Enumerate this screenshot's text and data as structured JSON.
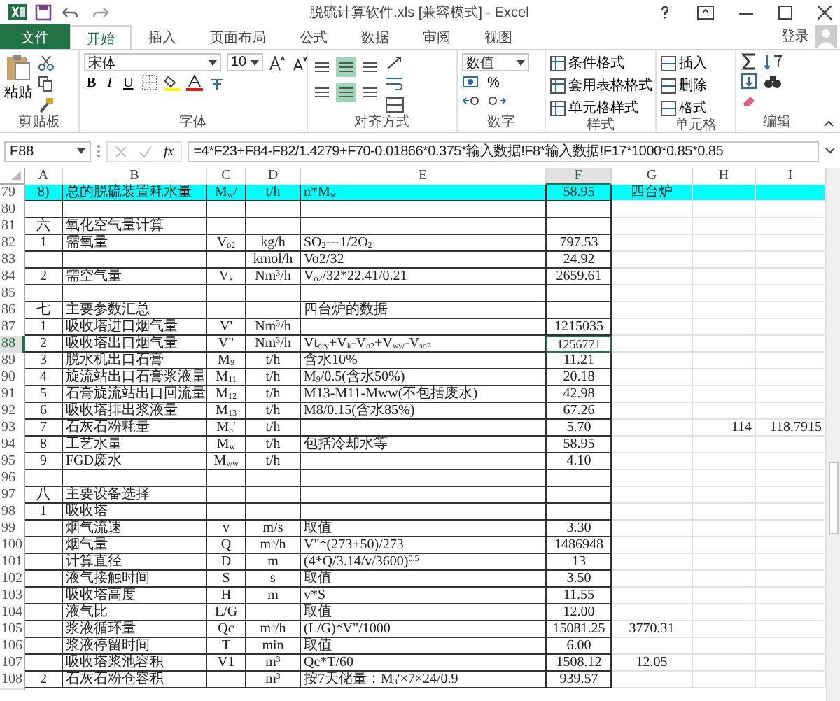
{
  "window": {
    "title": "脱硫计算软件.xls  [兼容模式] - Excel"
  },
  "tabs": [
    {
      "label": "文件",
      "kind": "file",
      "selected": false
    },
    {
      "label": "开始",
      "kind": "tab",
      "selected": true
    },
    {
      "label": "插入",
      "kind": "tab",
      "selected": false
    },
    {
      "label": "页面布局",
      "kind": "tab",
      "selected": false
    },
    {
      "label": "公式",
      "kind": "tab",
      "selected": false
    },
    {
      "label": "数据",
      "kind": "tab",
      "selected": false
    },
    {
      "label": "审阅",
      "kind": "tab",
      "selected": false
    },
    {
      "label": "视图",
      "kind": "tab",
      "selected": false
    }
  ],
  "signin": "登录",
  "ribbon": {
    "clipboard": {
      "paste": "粘贴",
      "label": "剪贴板"
    },
    "font": {
      "name": "宋体",
      "size": "10",
      "styles": [
        "B",
        "I",
        "U"
      ],
      "label": "字体"
    },
    "alignment": {
      "buttons": [
        {
          "selected": false
        },
        {
          "selected": true
        },
        {
          "selected": false
        },
        {
          "selected": false
        },
        {
          "selected": true
        },
        {
          "selected": false
        }
      ],
      "label": "对齐方式"
    },
    "number": {
      "format": "数值",
      "percent": "%",
      "label": "数字"
    },
    "styles": {
      "items": [
        "条件格式",
        "套用表格格式",
        "单元格样式"
      ],
      "label": "样式"
    },
    "cells": {
      "items": [
        "插入",
        "删除",
        "格式"
      ],
      "label": "单元格"
    },
    "editing": {
      "label": "编辑"
    }
  },
  "formula_bar": {
    "name_box": "F88",
    "fx": "fx",
    "formula": "=4*F23+F84-F82/1.4279+F70-0.01866*0.375*输入数据!F8*输入数据!F17*1000*0.85*0.85"
  },
  "columns": [
    {
      "label": "A",
      "selected": false
    },
    {
      "label": "B",
      "selected": false
    },
    {
      "label": "C",
      "selected": false
    },
    {
      "label": "D",
      "selected": false
    },
    {
      "label": "E",
      "selected": false
    },
    {
      "label": "F",
      "selected": true
    },
    {
      "label": "G",
      "selected": false
    },
    {
      "label": "H",
      "selected": false
    },
    {
      "label": "I",
      "selected": false
    }
  ],
  "rows": [
    {
      "row": "79",
      "selected": false,
      "highlighted": true,
      "cells": {
        "a": "8)",
        "b": "总的脱硫装置耗水量",
        "c": "M$_{w}$/",
        "d": "t/h",
        "e": "n*M$_{w}$",
        "f": "58.95",
        "g": "四台炉"
      }
    },
    {
      "row": "80",
      "selected": false,
      "highlighted": false,
      "cells": {}
    },
    {
      "row": "81",
      "selected": false,
      "highlighted": false,
      "cells": {
        "a": "六",
        "b": "氧化空气量计算"
      }
    },
    {
      "row": "82",
      "selected": false,
      "highlighted": false,
      "cells": {
        "a": "1",
        "b": "需氧量",
        "c": "V$_{o2}$",
        "d": "kg/h",
        "e": "SO$_{2}$---1/2O$_{2}$",
        "f": "797.53"
      }
    },
    {
      "row": "83",
      "selected": false,
      "highlighted": false,
      "cells": {
        "d": "kmol/h",
        "e": "Vo2/32",
        "f": "24.92"
      }
    },
    {
      "row": "84",
      "selected": false,
      "highlighted": false,
      "cells": {
        "a": "2",
        "b": "需空气量",
        "c": "V$_{k}$",
        "d": "Nm$^{3}$/h",
        "e": "V$_{o2}$/32*22.41/0.21",
        "f": "2659.61"
      }
    },
    {
      "row": "85",
      "selected": false,
      "highlighted": false,
      "cells": {}
    },
    {
      "row": "86",
      "selected": false,
      "highlighted": false,
      "cells": {
        "a": "七",
        "b": "主要参数汇总",
        "e": "四台炉的数据"
      }
    },
    {
      "row": "87",
      "selected": false,
      "highlighted": false,
      "cells": {
        "a": "1",
        "b": "吸收塔进口烟气量",
        "c": "V'",
        "d": "Nm$^{3}$/h",
        "f": "1215035"
      }
    },
    {
      "row": "88",
      "selected": true,
      "highlighted": false,
      "cells": {
        "a": "2",
        "b": "吸收塔出口烟气量",
        "c": "V\"",
        "d": "Nm$^{3}$/h",
        "e": "Vt$_{dry}$+V$_{k}$-V$_{o2}$+V$_{ww}$-V$_{so2}$",
        "f": "1256771"
      }
    },
    {
      "row": "89",
      "selected": false,
      "highlighted": false,
      "cells": {
        "a": "3",
        "b": "脱水机出口石膏",
        "c": "M$_{9}$",
        "d": "t/h",
        "e": "含水10%",
        "f": "11.21"
      }
    },
    {
      "row": "90",
      "selected": false,
      "highlighted": false,
      "cells": {
        "a": "4",
        "b": "旋流站出口石膏浆液量",
        "c": "M$_{11}$",
        "d": "t/h",
        "e": "M$_{9}$/0.5(含水50%)",
        "f": "20.18"
      }
    },
    {
      "row": "91",
      "selected": false,
      "highlighted": false,
      "cells": {
        "a": "5",
        "b": "石膏旋流站出口回流量",
        "c": "M$_{12}$",
        "d": "t/h",
        "e": "M13-M11-Mww(不包括废水)",
        "f": "42.98"
      }
    },
    {
      "row": "92",
      "selected": false,
      "highlighted": false,
      "cells": {
        "a": "6",
        "b": "吸收塔排出浆液量",
        "c": "M$_{13}$",
        "d": "t/h",
        "e": "M8/0.15(含水85%)",
        "f": "67.26"
      }
    },
    {
      "row": "93",
      "selected": false,
      "highlighted": false,
      "cells": {
        "a": "7",
        "b": "石灰石粉耗量",
        "c": "M$_{3}$'",
        "d": "t/h",
        "f": "5.70",
        "h": "114",
        "i": "118.7915"
      }
    },
    {
      "row": "94",
      "selected": false,
      "highlighted": false,
      "cells": {
        "a": "8",
        "b": "工艺水量",
        "c": "M$_{w}$",
        "d": "t/h",
        "e": "包括冷却水等",
        "f": "58.95"
      }
    },
    {
      "row": "95",
      "selected": false,
      "highlighted": false,
      "cells": {
        "a": "9",
        "b": "FGD废水",
        "c": "M$_{ww}$",
        "d": "t/h",
        "f": "4.10"
      }
    },
    {
      "row": "96",
      "selected": false,
      "highlighted": false,
      "cells": {}
    },
    {
      "row": "97",
      "selected": false,
      "highlighted": false,
      "cells": {
        "a": "八",
        "b": "主要设备选择"
      }
    },
    {
      "row": "98",
      "selected": false,
      "highlighted": false,
      "cells": {
        "a": "1",
        "b": "吸收塔"
      }
    },
    {
      "row": "99",
      "selected": false,
      "highlighted": false,
      "cells": {
        "b": "烟气流速",
        "c": "v",
        "d": "m/s",
        "e": "取值",
        "f": "3.30"
      }
    },
    {
      "row": "100",
      "selected": false,
      "highlighted": false,
      "cells": {
        "b": "烟气量",
        "c": "Q",
        "d": "m$^{3}$/h",
        "e": "V\"*(273+50)/273",
        "f": "1486948"
      }
    },
    {
      "row": "101",
      "selected": false,
      "highlighted": false,
      "cells": {
        "b": "计算直径",
        "c": "D",
        "d": "m",
        "e": "(4*Q/3.14/v/3600)$^{0.5}$",
        "f": "13"
      }
    },
    {
      "row": "102",
      "selected": false,
      "highlighted": false,
      "cells": {
        "b": "液气接触时间",
        "c": "S",
        "d": "s",
        "e": "取值",
        "f": "3.50"
      }
    },
    {
      "row": "103",
      "selected": false,
      "highlighted": false,
      "cells": {
        "b": "吸收塔高度",
        "c": "H",
        "d": "m",
        "e": "v*S",
        "f": "11.55"
      }
    },
    {
      "row": "104",
      "selected": false,
      "highlighted": false,
      "cells": {
        "b": "液气比",
        "c": "L/G",
        "e": "取值",
        "f": "12.00"
      }
    },
    {
      "row": "105",
      "selected": false,
      "highlighted": false,
      "cells": {
        "b": "浆液循环量",
        "c": "Qc",
        "d": "m$^{3}$/h",
        "e": "(L/G)*V\"/1000",
        "f": "15081.25",
        "g": "3770.31"
      }
    },
    {
      "row": "106",
      "selected": false,
      "highlighted": false,
      "cells": {
        "b": "浆液停留时间",
        "c": "T",
        "d": "min",
        "e": "取值",
        "f": "6.00"
      }
    },
    {
      "row": "107",
      "selected": false,
      "highlighted": false,
      "cells": {
        "b": "吸收塔浆池容积",
        "c": "V1",
        "d": "m$^{3}$",
        "e": "Qc*T/60",
        "f": "1508.12",
        "g": "12.05"
      }
    },
    {
      "row": "108",
      "selected": false,
      "highlighted": false,
      "cells": {
        "a": "2",
        "b": "石灰石粉仓容积",
        "d": "m$^{3}$",
        "e": "按7天储量：M$_{3}$'×7×24/0.9",
        "f": "939.57"
      }
    }
  ]
}
